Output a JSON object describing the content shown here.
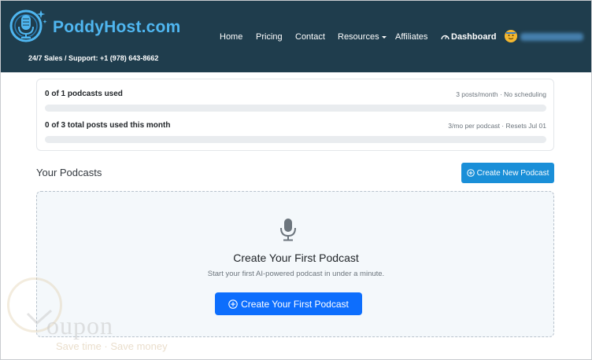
{
  "header": {
    "logo_text": "PoddyHost.com",
    "support": "24/7 Sales / Support: +1 (978) 643-8662",
    "nav": [
      {
        "label": "Home"
      },
      {
        "label": "Pricing"
      },
      {
        "label": "Contact"
      },
      {
        "label": "Resources"
      },
      {
        "label": "Affiliates"
      },
      {
        "label": "Dashboard"
      }
    ],
    "user_icon": "avatar-icon"
  },
  "usage": {
    "podcasts": {
      "label": "0 of 1 podcasts used",
      "meta": "3 posts/month · No scheduling",
      "progress": 0
    },
    "posts": {
      "label": "0 of 3 total posts used this month",
      "meta": "3/mo per podcast · Resets Jul 01",
      "progress": 0
    }
  },
  "section": {
    "title": "Your Podcasts",
    "create_new_label": "Create New Podcast"
  },
  "empty_state": {
    "icon": "microphone-icon",
    "title": "Create Your First Podcast",
    "subtitle": "Start your first AI-powered podcast in under a minute.",
    "button_label": "Create Your First Podcast"
  },
  "watermark": {
    "text": "oupon",
    "tagline": "Save time · Save money"
  },
  "colors": {
    "header_bg": "#1f3d4d",
    "logo_blue": "#4fb6f0",
    "primary": "#0d6efd",
    "secondary_btn": "#1a8fd8"
  }
}
